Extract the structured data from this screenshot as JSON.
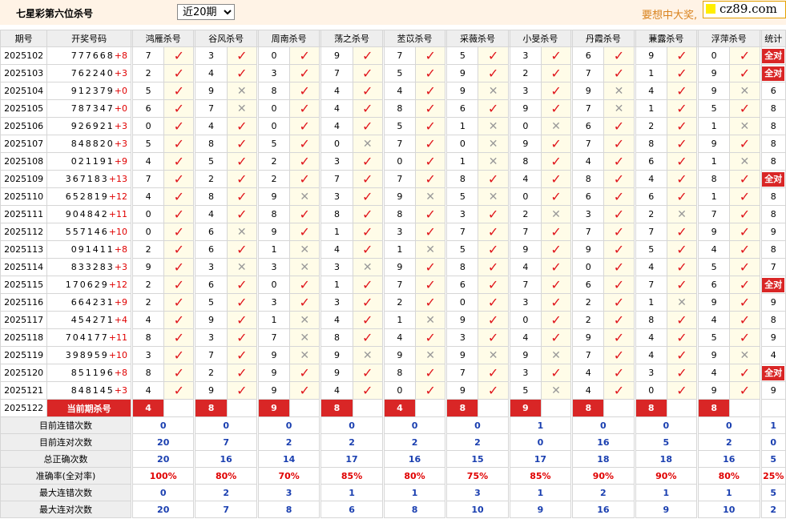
{
  "header": {
    "title": "七星彩第六位杀号",
    "period_select": "近20期",
    "promo": "要想中大奖,",
    "logo": "cz89.com"
  },
  "table": {
    "col_period": "期号",
    "col_draw": "开奖号码",
    "col_stats": "统计",
    "experts": [
      "鸿雁杀号",
      "谷风杀号",
      "周南杀号",
      "荡之杀号",
      "苤苡杀号",
      "采薇杀号",
      "小旻杀号",
      "丹霞杀号",
      "蒹露杀号",
      "浮萍杀号"
    ],
    "rows": [
      {
        "period": "2025102",
        "draw": "777668",
        "sum": "+8",
        "kills": [
          "7",
          "3",
          "0",
          "9",
          "7",
          "5",
          "3",
          "6",
          "9",
          "0"
        ],
        "hits": [
          1,
          1,
          1,
          1,
          1,
          1,
          1,
          1,
          1,
          1
        ],
        "stat": "全对"
      },
      {
        "period": "2025103",
        "draw": "762240",
        "sum": "+3",
        "kills": [
          "2",
          "4",
          "3",
          "7",
          "5",
          "9",
          "2",
          "7",
          "1",
          "9"
        ],
        "hits": [
          1,
          1,
          1,
          1,
          1,
          1,
          1,
          1,
          1,
          1
        ],
        "stat": "全对"
      },
      {
        "period": "2025104",
        "draw": "912379",
        "sum": "+0",
        "kills": [
          "5",
          "9",
          "8",
          "4",
          "4",
          "9",
          "3",
          "9",
          "4",
          "9"
        ],
        "hits": [
          1,
          0,
          1,
          1,
          1,
          0,
          1,
          0,
          1,
          0
        ],
        "stat": "6"
      },
      {
        "period": "2025105",
        "draw": "787347",
        "sum": "+0",
        "kills": [
          "6",
          "7",
          "0",
          "4",
          "8",
          "6",
          "9",
          "7",
          "1",
          "5"
        ],
        "hits": [
          1,
          0,
          1,
          1,
          1,
          1,
          1,
          0,
          1,
          1
        ],
        "stat": "8"
      },
      {
        "period": "2025106",
        "draw": "926921",
        "sum": "+3",
        "kills": [
          "0",
          "4",
          "0",
          "4",
          "5",
          "1",
          "0",
          "6",
          "2",
          "1"
        ],
        "hits": [
          1,
          1,
          1,
          1,
          1,
          0,
          0,
          1,
          1,
          0
        ],
        "stat": "8"
      },
      {
        "period": "2025107",
        "draw": "848820",
        "sum": "+3",
        "kills": [
          "5",
          "8",
          "5",
          "0",
          "7",
          "0",
          "9",
          "7",
          "8",
          "9"
        ],
        "hits": [
          1,
          1,
          1,
          0,
          1,
          0,
          1,
          1,
          1,
          1
        ],
        "stat": "8"
      },
      {
        "period": "2025108",
        "draw": "021191",
        "sum": "+9",
        "kills": [
          "4",
          "5",
          "2",
          "3",
          "0",
          "1",
          "8",
          "4",
          "6",
          "1"
        ],
        "hits": [
          1,
          1,
          1,
          1,
          1,
          0,
          1,
          1,
          1,
          0
        ],
        "stat": "8"
      },
      {
        "period": "2025109",
        "draw": "367183",
        "sum": "+13",
        "kills": [
          "7",
          "2",
          "2",
          "7",
          "7",
          "8",
          "4",
          "8",
          "4",
          "8"
        ],
        "hits": [
          1,
          1,
          1,
          1,
          1,
          1,
          1,
          1,
          1,
          1
        ],
        "stat": "全对"
      },
      {
        "period": "2025110",
        "draw": "652819",
        "sum": "+12",
        "kills": [
          "4",
          "8",
          "9",
          "3",
          "9",
          "5",
          "0",
          "6",
          "6",
          "1"
        ],
        "hits": [
          1,
          1,
          0,
          1,
          0,
          0,
          1,
          1,
          1,
          1
        ],
        "stat": "8"
      },
      {
        "period": "2025111",
        "draw": "904842",
        "sum": "+11",
        "kills": [
          "0",
          "4",
          "8",
          "8",
          "8",
          "3",
          "2",
          "3",
          "2",
          "7"
        ],
        "hits": [
          1,
          1,
          1,
          1,
          1,
          1,
          0,
          1,
          0,
          1
        ],
        "stat": "8"
      },
      {
        "period": "2025112",
        "draw": "557146",
        "sum": "+10",
        "kills": [
          "0",
          "6",
          "9",
          "1",
          "3",
          "7",
          "7",
          "7",
          "7",
          "9"
        ],
        "hits": [
          1,
          0,
          1,
          1,
          1,
          1,
          1,
          1,
          1,
          1
        ],
        "stat": "9"
      },
      {
        "period": "2025113",
        "draw": "091411",
        "sum": "+8",
        "kills": [
          "2",
          "6",
          "1",
          "4",
          "1",
          "5",
          "9",
          "9",
          "5",
          "4"
        ],
        "hits": [
          1,
          1,
          0,
          1,
          0,
          1,
          1,
          1,
          1,
          1
        ],
        "stat": "8"
      },
      {
        "period": "2025114",
        "draw": "833283",
        "sum": "+3",
        "kills": [
          "9",
          "3",
          "3",
          "3",
          "9",
          "8",
          "4",
          "0",
          "4",
          "5"
        ],
        "hits": [
          1,
          0,
          0,
          0,
          1,
          1,
          1,
          1,
          1,
          1
        ],
        "stat": "7"
      },
      {
        "period": "2025115",
        "draw": "170629",
        "sum": "+12",
        "kills": [
          "2",
          "6",
          "0",
          "1",
          "7",
          "6",
          "7",
          "6",
          "7",
          "6"
        ],
        "hits": [
          1,
          1,
          1,
          1,
          1,
          1,
          1,
          1,
          1,
          1
        ],
        "stat": "全对"
      },
      {
        "period": "2025116",
        "draw": "664231",
        "sum": "+9",
        "kills": [
          "2",
          "5",
          "3",
          "3",
          "2",
          "0",
          "3",
          "2",
          "1",
          "9"
        ],
        "hits": [
          1,
          1,
          1,
          1,
          1,
          1,
          1,
          1,
          0,
          1
        ],
        "stat": "9"
      },
      {
        "period": "2025117",
        "draw": "454271",
        "sum": "+4",
        "kills": [
          "4",
          "9",
          "1",
          "4",
          "1",
          "9",
          "0",
          "2",
          "8",
          "4"
        ],
        "hits": [
          1,
          1,
          0,
          1,
          0,
          1,
          1,
          1,
          1,
          1
        ],
        "stat": "8"
      },
      {
        "period": "2025118",
        "draw": "704177",
        "sum": "+11",
        "kills": [
          "8",
          "3",
          "7",
          "8",
          "4",
          "3",
          "4",
          "9",
          "4",
          "5"
        ],
        "hits": [
          1,
          1,
          0,
          1,
          1,
          1,
          1,
          1,
          1,
          1
        ],
        "stat": "9"
      },
      {
        "period": "2025119",
        "draw": "398959",
        "sum": "+10",
        "kills": [
          "3",
          "7",
          "9",
          "9",
          "9",
          "9",
          "9",
          "7",
          "4",
          "9"
        ],
        "hits": [
          1,
          1,
          0,
          0,
          0,
          0,
          0,
          1,
          1,
          0
        ],
        "stat": "4"
      },
      {
        "period": "2025120",
        "draw": "851196",
        "sum": "+8",
        "kills": [
          "8",
          "2",
          "9",
          "9",
          "8",
          "7",
          "3",
          "4",
          "3",
          "4"
        ],
        "hits": [
          1,
          1,
          1,
          1,
          1,
          1,
          1,
          1,
          1,
          1
        ],
        "stat": "全对"
      },
      {
        "period": "2025121",
        "draw": "848145",
        "sum": "+3",
        "kills": [
          "4",
          "9",
          "9",
          "4",
          "0",
          "9",
          "5",
          "4",
          "0",
          "9"
        ],
        "hits": [
          1,
          1,
          1,
          1,
          1,
          1,
          0,
          1,
          1,
          1
        ],
        "stat": "9"
      }
    ],
    "current": {
      "period": "2025122",
      "label": "当前期杀号",
      "kills": [
        "4",
        "8",
        "9",
        "8",
        "4",
        "8",
        "9",
        "8",
        "8",
        "8"
      ]
    },
    "stats": [
      {
        "label": "目前连错次数",
        "values": [
          "0",
          "0",
          "0",
          "0",
          "0",
          "0",
          "1",
          "0",
          "0",
          "0"
        ],
        "total": "1"
      },
      {
        "label": "目前连对次数",
        "values": [
          "20",
          "7",
          "2",
          "2",
          "2",
          "2",
          "0",
          "16",
          "5",
          "2"
        ],
        "total": "0"
      },
      {
        "label": "总正确次数",
        "values": [
          "20",
          "16",
          "14",
          "17",
          "16",
          "15",
          "17",
          "18",
          "18",
          "16"
        ],
        "total": "5"
      },
      {
        "label": "准确率(全对率)",
        "values": [
          "100%",
          "80%",
          "70%",
          "85%",
          "80%",
          "75%",
          "85%",
          "90%",
          "90%",
          "80%"
        ],
        "total": "25%"
      },
      {
        "label": "最大连错次数",
        "values": [
          "0",
          "2",
          "3",
          "1",
          "1",
          "3",
          "1",
          "2",
          "1",
          "1"
        ],
        "total": "5"
      },
      {
        "label": "最大连对次数",
        "values": [
          "20",
          "7",
          "8",
          "6",
          "8",
          "10",
          "9",
          "16",
          "9",
          "10"
        ],
        "total": "2"
      }
    ]
  },
  "marks": {
    "hit": "✓",
    "miss": "✕"
  },
  "colors": {
    "accent_red": "#d92626",
    "stat_blue": "#1a3fb0",
    "promo_orange": "#d9831f"
  }
}
